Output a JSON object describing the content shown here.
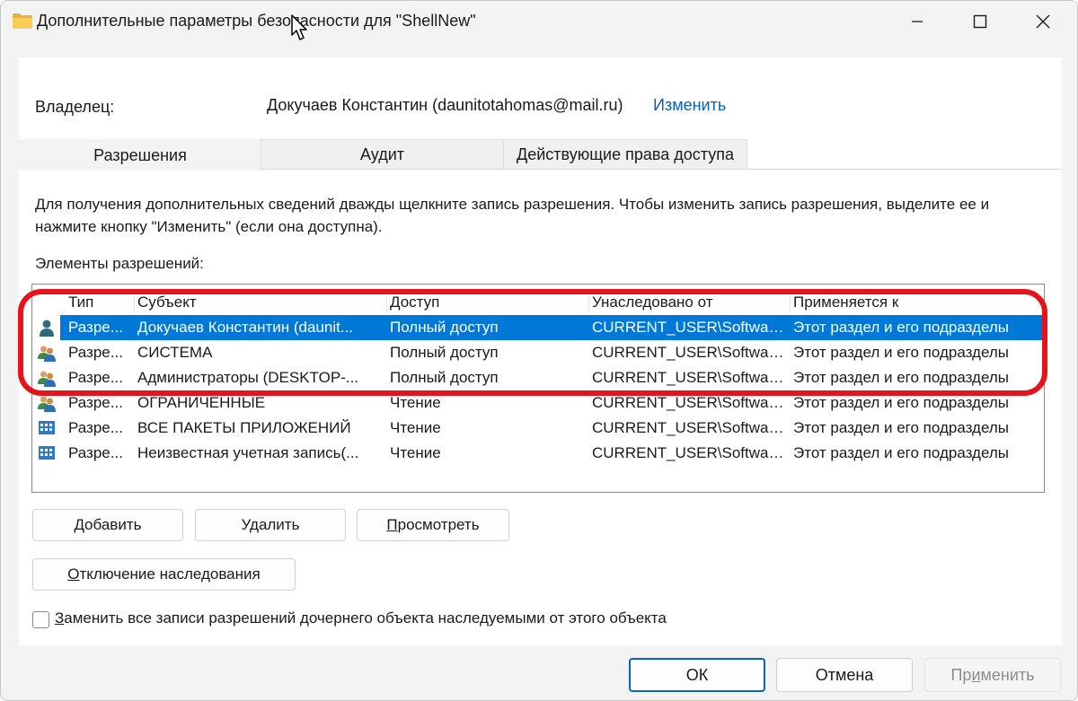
{
  "window": {
    "title": "Дополнительные параметры безопасности  для \"ShellNew\"",
    "controls": {
      "minimize": "minimize",
      "maximize": "maximize",
      "close": "close"
    }
  },
  "owner": {
    "label": "Владелец:",
    "value": "Докучаев Константин (daunitotahomas@mail.ru)",
    "change_link": "Изменить"
  },
  "tabs": [
    {
      "label": "Разрешения",
      "active": true
    },
    {
      "label": "Аудит",
      "active": false
    },
    {
      "label": "Действующие права доступа",
      "active": false
    }
  ],
  "description": "Для получения дополнительных сведений дважды щелкните запись разрешения. Чтобы изменить запись разрешения, выделите ее и нажмите кнопку \"Изменить\" (если она доступна).",
  "permissions_caption": "Элементы разрешений:",
  "permissions_table": {
    "columns": [
      "Тип",
      "Субъект",
      "Доступ",
      "Унаследовано от",
      "Применяется к"
    ],
    "rows": [
      {
        "icon": "user-icon",
        "type": "Разре...",
        "subject": "Докучаев Константин (daunit...",
        "access": "Полный доступ",
        "inherited_from": "CURRENT_USER\\Softwar...",
        "applies_to": "Этот раздел и его подразделы",
        "selected": true
      },
      {
        "icon": "group-icon",
        "type": "Разре...",
        "subject": "СИСТЕМА",
        "access": "Полный доступ",
        "inherited_from": "CURRENT_USER\\Softwar...",
        "applies_to": "Этот раздел и его подразделы",
        "selected": false
      },
      {
        "icon": "group-icon",
        "type": "Разре...",
        "subject": "Администраторы (DESKTOP-...",
        "access": "Полный доступ",
        "inherited_from": "CURRENT_USER\\Softwar...",
        "applies_to": "Этот раздел и его подразделы",
        "selected": false
      },
      {
        "icon": "group-icon",
        "type": "Разре...",
        "subject": "ОГРАНИЧЕННЫЕ",
        "access": "Чтение",
        "inherited_from": "CURRENT_USER\\Softwar...",
        "applies_to": "Этот раздел и его подразделы",
        "selected": false
      },
      {
        "icon": "app-package-icon",
        "type": "Разре...",
        "subject": "ВСЕ ПАКЕТЫ ПРИЛОЖЕНИЙ",
        "access": "Чтение",
        "inherited_from": "CURRENT_USER\\Softwar...",
        "applies_to": "Этот раздел и его подразделы",
        "selected": false
      },
      {
        "icon": "app-package-icon",
        "type": "Разре...",
        "subject": "Неизвестная учетная запись(...",
        "access": "Чтение",
        "inherited_from": "CURRENT_USER\\Softwar...",
        "applies_to": "Этот раздел и его подразделы",
        "selected": false
      }
    ]
  },
  "buttons": {
    "add": {
      "mnemonic": "Д",
      "rest": "обавить"
    },
    "remove": "Удалить",
    "view": {
      "mnemonic": "П",
      "rest": "росмотреть"
    },
    "disable_inheritance": {
      "mnemonic": "О",
      "rest": "тключение наследования"
    }
  },
  "replace_checkbox": {
    "mnemonic": "З",
    "rest": "аменить все записи разрешений дочернего объекта наследуемыми от этого объекта",
    "checked": false
  },
  "dialog_buttons": {
    "ok": "ОК",
    "cancel": "Отмена",
    "apply": {
      "before": "Пр",
      "mnemonic": "и",
      "after": "менить",
      "enabled": false
    }
  },
  "colors": {
    "selection": "#0078d7",
    "link": "#0b5fb5",
    "highlight_annotation": "#e3141c",
    "ok_border": "#0067c0"
  }
}
